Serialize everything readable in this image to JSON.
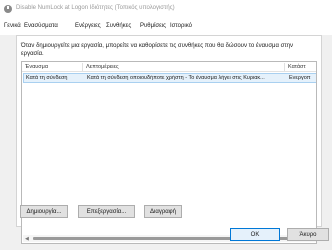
{
  "window": {
    "title": "Disable NumLock at Logon Ιδιότητες (Τοπικός υπολογιστής)",
    "icon": "clock-icon"
  },
  "tabs": [
    {
      "label": "Γενικά"
    },
    {
      "label": "Ενεργοποιήσεις",
      "display": "Ενασύσματα",
      "active": true
    },
    {
      "label": "Ενέργειες"
    },
    {
      "label": "Συνθήκες"
    },
    {
      "label": "Ρυθμίσεις"
    },
    {
      "label": "Ιστορικό"
    }
  ],
  "description": "Όταν δημιουργείτε μια εργασία, μπορείτε να καθορίσετε τις συνθήκες που θα δώσουν το έναυσμα στην εργασία.",
  "list": {
    "columns": [
      "Έναυσμα",
      "Λεπτομέρειες",
      "Κατάστ"
    ],
    "rows": [
      {
        "trigger": "Κατά τη σύνδεση",
        "details": "Κατά τη σύνδεση οποιουδήποτε χρήστη - Το έναυσμα λήγει στις Κυριακ...",
        "status": "Ενεργοπ"
      }
    ]
  },
  "buttons": {
    "new": "Δημιουργία...",
    "edit": "Επεξεργασία...",
    "delete": "Διαγραφή",
    "ok": "OK",
    "cancel": "Άκυρο"
  },
  "scrollbar": {
    "left_arrow": "◀",
    "right_arrow": "▶"
  }
}
